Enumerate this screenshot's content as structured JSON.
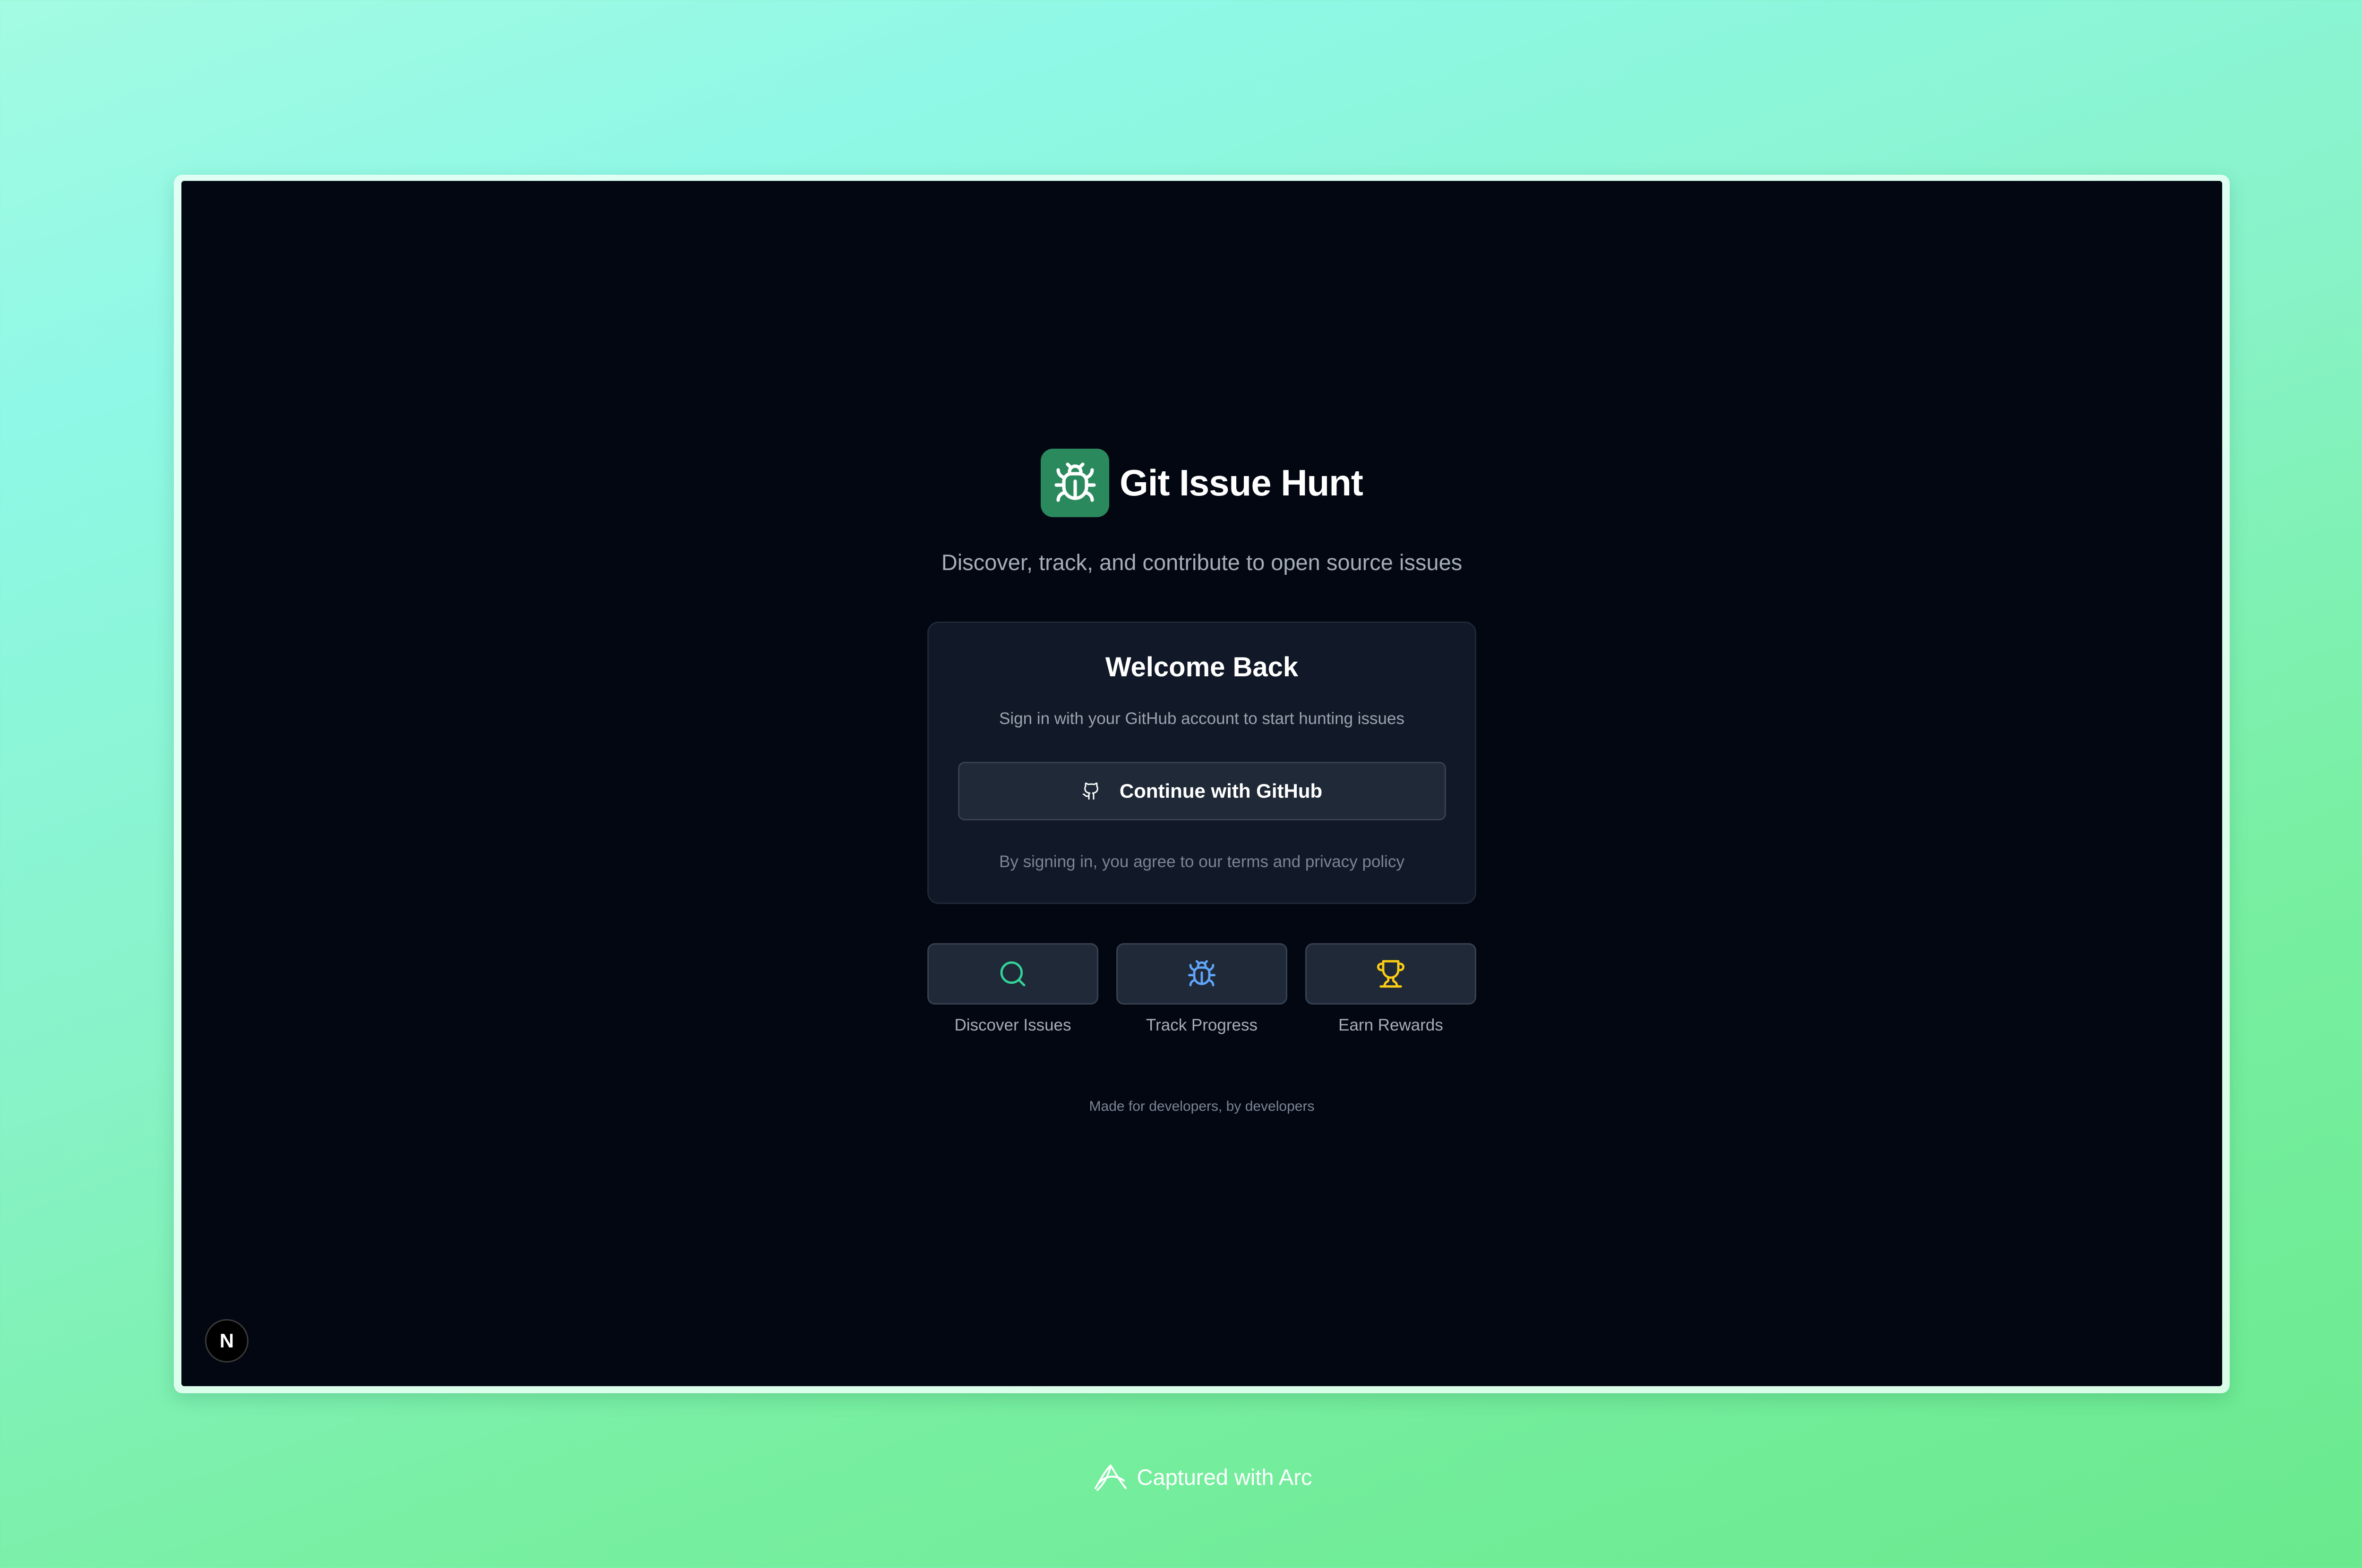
{
  "app": {
    "title": "Git Issue Hunt",
    "tagline": "Discover, track, and contribute to open source issues",
    "logo_icon": "bug-icon",
    "accent_color": "#2a8a5e"
  },
  "login_card": {
    "title": "Welcome Back",
    "subtitle": "Sign in with your GitHub account to start hunting issues",
    "github_button_label": "Continue with GitHub",
    "github_button_icon": "github-icon",
    "legal_text": "By signing in, you agree to our terms and privacy policy"
  },
  "features": [
    {
      "label": "Discover Issues",
      "icon": "search-icon",
      "color": "#34d399"
    },
    {
      "label": "Track Progress",
      "icon": "bug-icon",
      "color": "#60a5fa"
    },
    {
      "label": "Earn Rewards",
      "icon": "trophy-icon",
      "color": "#facc15"
    }
  ],
  "footer_note": "Made for developers, by developers",
  "dev_badge": {
    "label": "N",
    "icon": "nextjs-icon"
  },
  "capture_caption": {
    "text": "Captured with Arc",
    "icon": "arc-icon"
  }
}
